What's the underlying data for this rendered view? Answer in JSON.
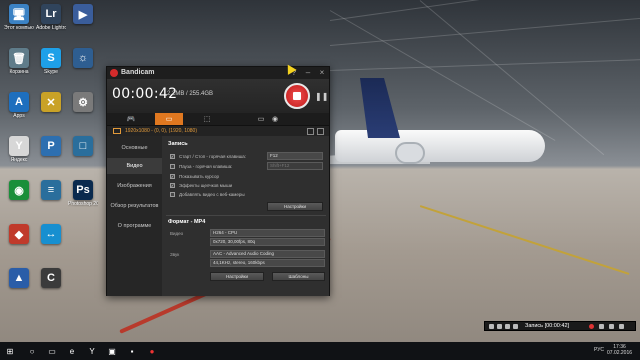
{
  "desktop": {
    "icons": [
      {
        "label": "Этот компьютер",
        "color": "#3b82c4",
        "glyph": "🖥"
      },
      {
        "label": "Корзина",
        "color": "#5f7c8a",
        "glyph": "🗑"
      },
      {
        "label": "Apps",
        "color": "#1e6fbe",
        "glyph": "A"
      },
      {
        "label": "Яндекс",
        "color": "#d7d7d7",
        "glyph": "Y"
      },
      {
        "label": "",
        "color": "#1a8f3a",
        "glyph": "◉"
      },
      {
        "label": "",
        "color": "#c03a2b",
        "glyph": "◆"
      },
      {
        "label": "",
        "color": "#2a5da8",
        "glyph": "▲"
      },
      {
        "label": "Adobe Lightroom",
        "color": "#30445c",
        "glyph": "Lr"
      },
      {
        "label": "Skype",
        "color": "#1ea0e8",
        "glyph": "S"
      },
      {
        "label": "",
        "color": "#c9a227",
        "glyph": "✕"
      },
      {
        "label": "",
        "color": "#2d6fb0",
        "glyph": "P"
      },
      {
        "label": "",
        "color": "#2a6e9c",
        "glyph": "≡"
      },
      {
        "label": "",
        "color": "#178fd0",
        "glyph": "↔"
      },
      {
        "label": "",
        "color": "#3b3b3b",
        "glyph": "C"
      },
      {
        "label": "",
        "color": "#3a5d9b",
        "glyph": "▶"
      },
      {
        "label": "",
        "color": "#2e5e91",
        "glyph": "☼"
      },
      {
        "label": "",
        "color": "#7a7a7a",
        "glyph": "⚙"
      },
      {
        "label": "",
        "color": "#2a6e9c",
        "glyph": "□"
      },
      {
        "label": "Photoshop 2015",
        "color": "#0a2a4e",
        "glyph": "Ps"
      }
    ]
  },
  "bandicam": {
    "title": "Bandicam",
    "timer": "00:00:42",
    "filesize": "2.2MB / 255.4GB",
    "region": "1920x1080 - (0, 0), (1920, 1080)",
    "modes": [
      "🎮",
      "▭",
      "⬚"
    ],
    "sidebar": [
      "Основные",
      "Видео",
      "Изображения",
      "Обзор результатов",
      "О программе"
    ],
    "record_section": "Запись",
    "options": [
      {
        "label": "Старт / Стоп - горячая клавиша:",
        "checked": true,
        "value": "F12"
      },
      {
        "label": "Пауза - горячая клавиша:",
        "checked": false,
        "value": "Shift+F12"
      },
      {
        "label": "Показывать курсор",
        "checked": true
      },
      {
        "label": "Эффекты щелчков мыши",
        "checked": true
      },
      {
        "label": "Добавлять видео с веб-камеры",
        "checked": false
      }
    ],
    "settings_button": "Настройки",
    "format_section": "Формат - MP4",
    "video_label": "Видео",
    "video_codec": "H264 - CPU",
    "video_params": "0x720, 30,00fps, 80q",
    "audio_label": "Звук",
    "audio_codec": "AAC - Advanced Audio Coding",
    "audio_params": "44,1KHz, stereo, 160kbps",
    "settings_button_2": "Настройки",
    "templates_button": "Шаблоны"
  },
  "mini_recorder": {
    "label": "Запись [00:00:42]"
  },
  "taskbar": {
    "language": "РУС",
    "time": "17:36",
    "date": "07.02.2016"
  }
}
